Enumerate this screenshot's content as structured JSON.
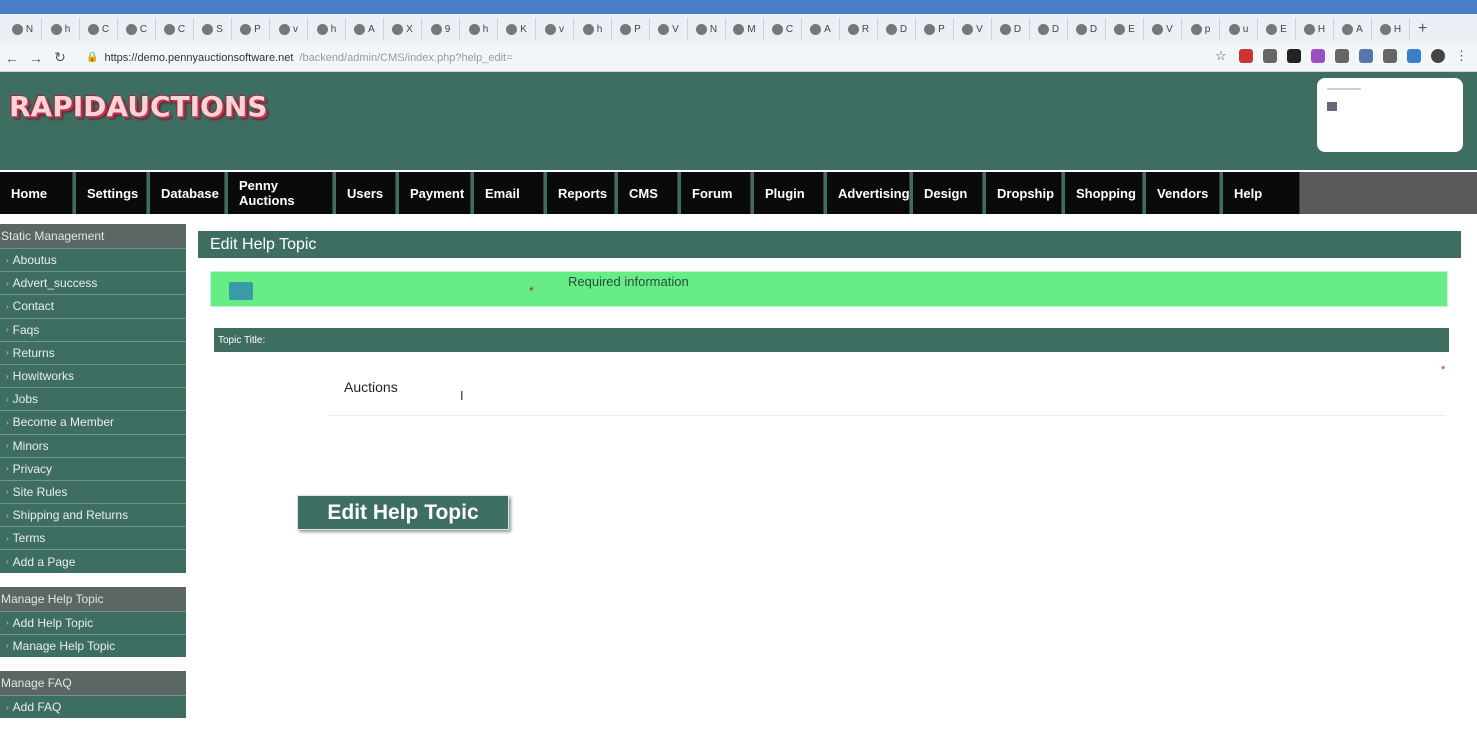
{
  "browser": {
    "tabs": [
      {
        "icon": "pin-icon",
        "letter": "N"
      },
      {
        "icon": "globe-icon",
        "letter": "h"
      },
      {
        "icon": "google-icon",
        "letter": "C"
      },
      {
        "icon": "google-icon",
        "letter": "C"
      },
      {
        "icon": "google-icon",
        "letter": "C"
      },
      {
        "icon": "google-icon",
        "letter": "S"
      },
      {
        "icon": "app-icon",
        "letter": "P"
      },
      {
        "icon": "globe-icon",
        "letter": "v"
      },
      {
        "icon": "globe-icon",
        "letter": "h"
      },
      {
        "icon": "globe-icon",
        "letter": "A"
      },
      {
        "icon": "globe-icon",
        "letter": "X"
      },
      {
        "icon": "app-icon",
        "letter": "9"
      },
      {
        "icon": "app-icon",
        "letter": "h"
      },
      {
        "icon": "app-icon",
        "letter": "K"
      },
      {
        "icon": "globe-icon",
        "letter": "v"
      },
      {
        "icon": "globe-icon",
        "letter": "h"
      },
      {
        "icon": "globe-icon",
        "letter": "P"
      },
      {
        "icon": "globe-icon",
        "letter": "V"
      },
      {
        "icon": "globe-icon",
        "letter": "N"
      },
      {
        "icon": "app-icon",
        "letter": "M"
      },
      {
        "icon": "app-icon",
        "letter": "C"
      },
      {
        "icon": "app-icon",
        "letter": "A"
      },
      {
        "icon": "gmail-icon",
        "letter": "R"
      },
      {
        "icon": "app-icon",
        "letter": "D"
      },
      {
        "icon": "app-icon",
        "letter": "P"
      },
      {
        "icon": "globe-icon",
        "letter": "V"
      },
      {
        "icon": "app-icon",
        "letter": "D"
      },
      {
        "icon": "app-icon",
        "letter": "D"
      },
      {
        "icon": "app-icon",
        "letter": "D"
      },
      {
        "icon": "app-icon",
        "letter": "E"
      },
      {
        "icon": "globe-icon",
        "letter": "V"
      },
      {
        "icon": "google-icon",
        "letter": "p"
      },
      {
        "icon": "globe-icon",
        "letter": "u"
      },
      {
        "icon": "google-icon",
        "letter": "E"
      },
      {
        "icon": "app-icon",
        "letter": "H"
      },
      {
        "icon": "google-icon",
        "letter": "A"
      },
      {
        "icon": "globe-icon",
        "letter": "H"
      }
    ],
    "url_host": "https://demo.pennyauctionsoftware.net",
    "url_path": "/backend/admin/CMS/index.php?help_edit="
  },
  "site": {
    "logo": "RAPIDAUCTIONS"
  },
  "nav": [
    "Home",
    "Settings",
    "Database",
    "Penny Auctions",
    "Users",
    "Payment",
    "Email",
    "Reports",
    "CMS",
    "Forum",
    "Plugin",
    "Advertising",
    "Design",
    "Dropship",
    "Shopping",
    "Vendors",
    "Help"
  ],
  "sidebar": {
    "static": {
      "title": "Static Management",
      "items": [
        "Aboutus",
        "Advert_success",
        "Contact",
        "Faqs",
        "Returns",
        "Howitworks",
        "Jobs",
        "Become a Member",
        "Minors",
        "Privacy",
        "Site Rules",
        "Shipping and Returns",
        "Terms",
        "Add a Page"
      ]
    },
    "help": {
      "title": "Manage Help Topic",
      "items": [
        "Add Help Topic",
        "Manage Help Topic"
      ]
    },
    "faq": {
      "title": "Manage FAQ",
      "items": [
        "Add FAQ"
      ]
    }
  },
  "content": {
    "page_title": "Edit Help Topic",
    "required_star": "*",
    "required_text": "Required information",
    "field_label": "Topic Title:",
    "title_value": "Auctions",
    "field_star": "*",
    "caret": "I",
    "submit_label": "Edit Help Topic"
  },
  "colors": {
    "header_bg": "#3e6e62",
    "nav_bg": "#0a0a0a",
    "required_bar": "#66ed85",
    "required_star": "#cc2020"
  }
}
